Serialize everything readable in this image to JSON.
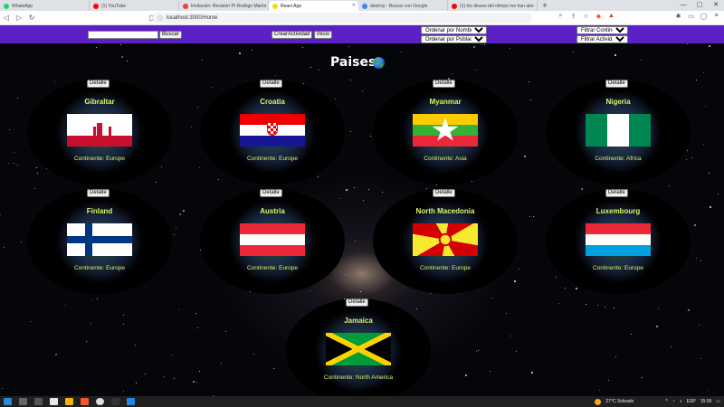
{
  "browser": {
    "tabs": [
      {
        "title": "WhatsApp",
        "color": "#25d366",
        "active": false
      },
      {
        "title": "(1) YouTube",
        "color": "#ff0000",
        "active": false
      },
      {
        "title": "Invitación: Revisión PI Rodrigo Martin",
        "color": "#ea4335",
        "active": false
      },
      {
        "title": "React App",
        "color": "#f5d90a",
        "active": true
      },
      {
        "title": "destroy - Buscar con Google",
        "color": "#4285f4",
        "active": false
      },
      {
        "title": "(1) los dioses del olimpo me han abo",
        "color": "#ff0000",
        "active": false
      }
    ],
    "url": "localhost:3000/Home"
  },
  "nav": {
    "search_placeholder": "",
    "search_label": "Buscar",
    "create_label": "CrearActividad",
    "home_label": "Inicio",
    "order_name": "Ordenar por Nombre",
    "order_population": "Ordenar por Población",
    "filter_continent": "Filtrar Continente",
    "filter_activities": "Filtrar Actividades"
  },
  "page": {
    "title": "Paises"
  },
  "cards": [
    {
      "name": "Gibraltar",
      "continent": "Continente: Europe",
      "detail": "Detalle",
      "flag": "gibraltar"
    },
    {
      "name": "Croatia",
      "continent": "Continente: Europe",
      "detail": "Detalle",
      "flag": "croatia"
    },
    {
      "name": "Myanmar",
      "continent": "Continente: Asia",
      "detail": "Detalle",
      "flag": "myanmar"
    },
    {
      "name": "Nigeria",
      "continent": "Continente: Africa",
      "detail": "Detalle",
      "flag": "nigeria"
    },
    {
      "name": "Finland",
      "continent": "Continente: Europe",
      "detail": "Detalle",
      "flag": "finland"
    },
    {
      "name": "Austria",
      "continent": "Continente: Europe",
      "detail": "Detalle",
      "flag": "austria"
    },
    {
      "name": "North Macedonia",
      "continent": "Continente: Europe",
      "detail": "Detalle",
      "flag": "macedonia"
    },
    {
      "name": "Luxembourg",
      "continent": "Continente: Europe",
      "detail": "Detalle",
      "flag": "luxembourg"
    },
    {
      "name": "Jamaica",
      "continent": "Continente: North America",
      "detail": "Detalle",
      "flag": "jamaica"
    }
  ],
  "taskbar": {
    "weather": "27°C  Soleado",
    "lang": "ESP",
    "time": "15:09"
  },
  "colors": {
    "nav_bg": "#5b21c4",
    "card_text": "#d8f56b"
  }
}
